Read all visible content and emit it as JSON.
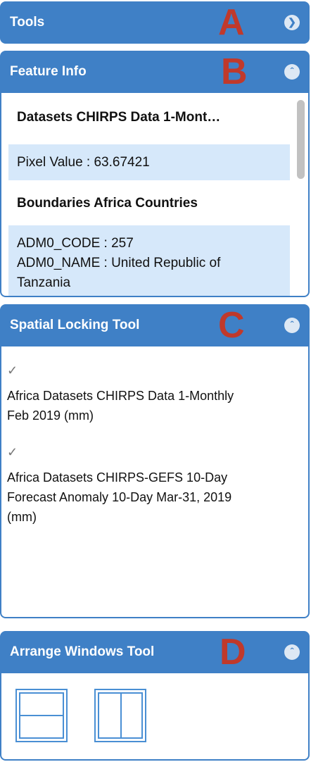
{
  "panels": {
    "tools": {
      "title": "Tools",
      "marker": "A",
      "toggle_icon": "chevron-right-icon"
    },
    "feature_info": {
      "title": "Feature Info",
      "marker": "B",
      "toggle_icon": "chevron-up-icon",
      "rows": [
        {
          "text": "Datasets CHIRPS Data 1-Mont…",
          "style": "heading"
        },
        {
          "text": "Pixel Value : 63.67421",
          "style": "value"
        },
        {
          "text": "Boundaries Africa Countries",
          "style": "heading"
        },
        {
          "lines": [
            "ADM0_CODE : 257",
            "ADM0_NAME : United Republic of",
            "Tanzania"
          ],
          "style": "value"
        }
      ]
    },
    "spatial_locking": {
      "title": "Spatial Locking Tool",
      "marker": "C",
      "toggle_icon": "chevron-up-icon",
      "items": [
        {
          "checked": true,
          "lines": [
            "Africa Datasets CHIRPS Data 1-Monthly",
            "Feb 2019 (mm)"
          ]
        },
        {
          "checked": true,
          "lines": [
            "Africa Datasets CHIRPS-GEFS 10-Day",
            "Forecast Anomaly 10-Day Mar-31, 2019",
            "(mm)"
          ]
        }
      ]
    },
    "arrange_windows": {
      "title": "Arrange Windows Tool",
      "marker": "D",
      "toggle_icon": "chevron-up-icon",
      "layouts": [
        "horizontal-split-icon",
        "vertical-split-icon"
      ]
    }
  },
  "colors": {
    "header": "#3f80c6",
    "marker": "#c0392b",
    "row_shade": "#d6e8fa"
  }
}
